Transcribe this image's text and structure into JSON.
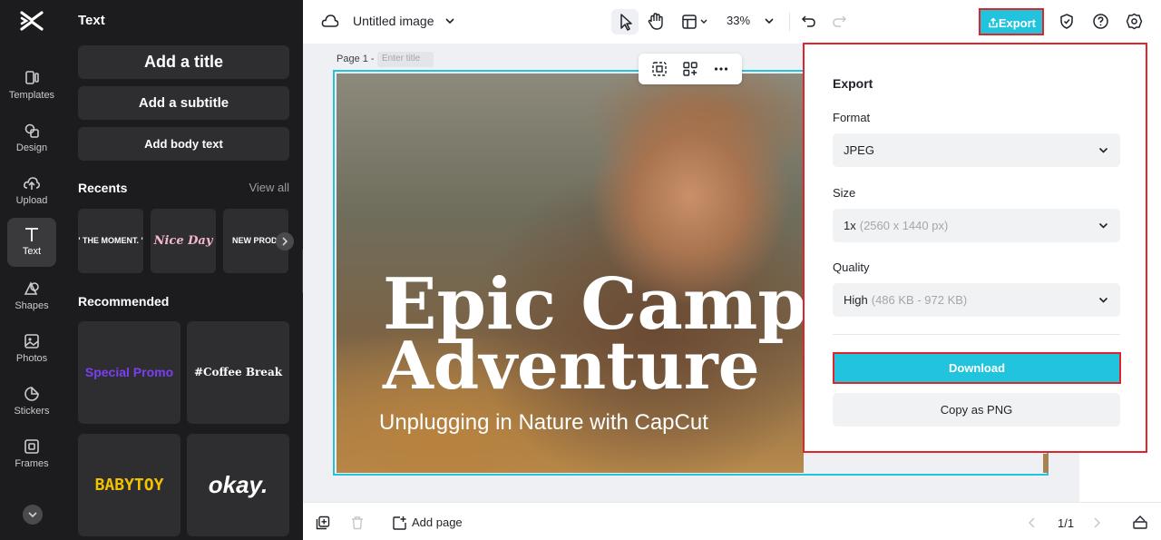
{
  "rail": {
    "items": [
      {
        "label": "Templates",
        "icon": "templates-icon"
      },
      {
        "label": "Design",
        "icon": "design-icon"
      },
      {
        "label": "Upload",
        "icon": "upload-icon"
      },
      {
        "label": "Text",
        "icon": "text-icon"
      },
      {
        "label": "Shapes",
        "icon": "shapes-icon"
      },
      {
        "label": "Photos",
        "icon": "photos-icon"
      },
      {
        "label": "Stickers",
        "icon": "stickers-icon"
      },
      {
        "label": "Frames",
        "icon": "frames-icon"
      }
    ],
    "active": "Text"
  },
  "text_panel": {
    "title": "Text",
    "add_title": "Add a title",
    "add_subtitle": "Add a subtitle",
    "add_body": "Add body text",
    "recents_title": "Recents",
    "view_all": "View all",
    "recents": [
      "' THE MOMENT. '",
      "Nice Day",
      "NEW PRODUCT"
    ],
    "recommended_title": "Recommended",
    "recommended": [
      "Special Promo",
      "#Coffee Break",
      "BABYTOY",
      "okay."
    ]
  },
  "topbar": {
    "doc_title": "Untitled image",
    "zoom": "33%",
    "export_label": "Export"
  },
  "canvas": {
    "page_label": "Page 1 -",
    "page_title_placeholder": "Enter title",
    "headline_line1": "Epic Campin",
    "headline_line2": "Adventure",
    "subheadline": "Unplugging in Nature with CapCut"
  },
  "bottombar": {
    "add_page": "Add page",
    "pager": "1/1"
  },
  "export_panel": {
    "title": "Export",
    "format_label": "Format",
    "format_value": "JPEG",
    "size_label": "Size",
    "size_value": "1x",
    "size_hint": "(2560 x 1440 px)",
    "quality_label": "Quality",
    "quality_value": "High",
    "quality_hint": "(486 KB - 972 KB)",
    "download_label": "Download",
    "copy_label": "Copy as PNG"
  },
  "colors": {
    "accent": "#21c3dd",
    "highlight_border": "#e0242b",
    "sidebar_bg": "#1c1c1e"
  }
}
